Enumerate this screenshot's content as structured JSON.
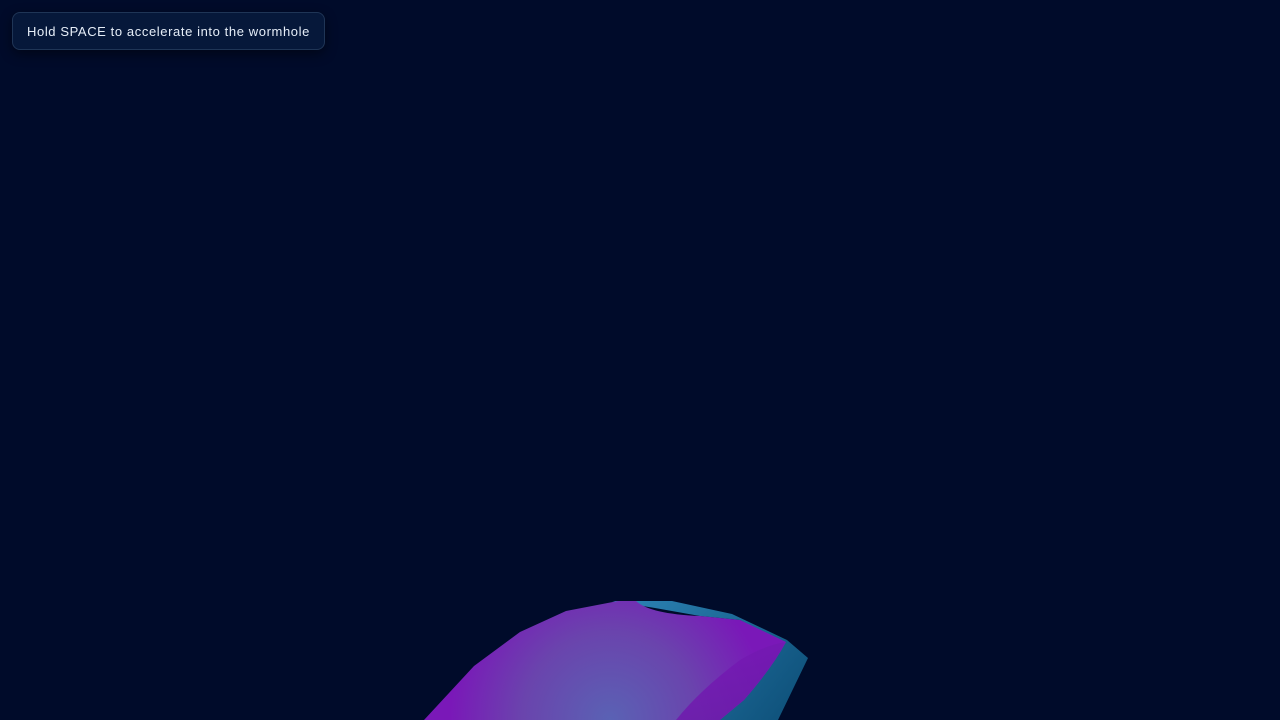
{
  "hud": {
    "hint_text": "Hold SPACE to accelerate into the wormhole"
  },
  "scene": {
    "background_color": "#000b2a",
    "object": "wormhole-tube",
    "colors": {
      "purple": "#7a18b8",
      "violet": "#5a5fb0",
      "teal": "#1a6a94",
      "deep_teal": "#0d4f78"
    }
  }
}
